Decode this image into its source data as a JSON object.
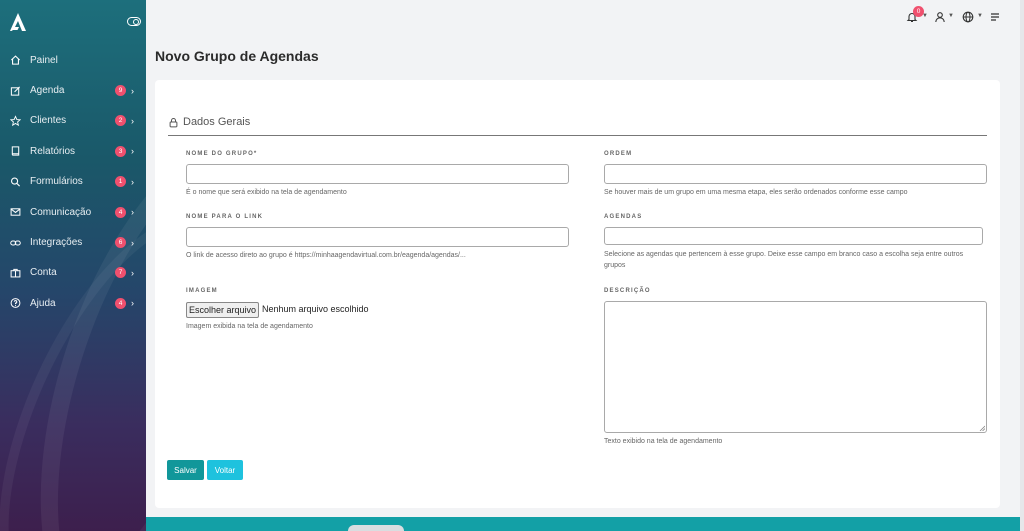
{
  "sidebar": {
    "items": [
      {
        "label": "Painel",
        "icon": "home-icon",
        "badge": null
      },
      {
        "label": "Agenda",
        "icon": "edit-icon",
        "badge": "9"
      },
      {
        "label": "Clientes",
        "icon": "star-icon",
        "badge": "2"
      },
      {
        "label": "Relatórios",
        "icon": "book-icon",
        "badge": "3"
      },
      {
        "label": "Formulários",
        "icon": "search-icon",
        "badge": "1"
      },
      {
        "label": "Comunicação",
        "icon": "mail-icon",
        "badge": "4"
      },
      {
        "label": "Integrações",
        "icon": "link-icon",
        "badge": "6"
      },
      {
        "label": "Conta",
        "icon": "briefcase-icon",
        "badge": "7"
      },
      {
        "label": "Ajuda",
        "icon": "help-icon",
        "badge": "4"
      }
    ]
  },
  "topbar": {
    "notifications_count": "0"
  },
  "page": {
    "title": "Novo Grupo de Agendas"
  },
  "form": {
    "section_title": "Dados Gerais",
    "nome_grupo_label": "NOME DO GRUPO*",
    "nome_grupo_help": "É o nome que será exibido na tela de agendamento",
    "ordem_label": "ORDEM",
    "ordem_help": "Se houver mais de um grupo em uma mesma etapa, eles serão ordenados conforme esse campo",
    "nome_link_label": "NOME PARA O LINK",
    "nome_link_help": "O link de acesso direto ao grupo é https://minhaagendavirtual.com.br/eagenda/agendas/...",
    "agendas_label": "AGENDAS",
    "agendas_help": "Selecione as agendas que pertencem à esse grupo. Deixe esse campo em branco caso a escolha seja entre outros grupos",
    "imagem_label": "IMAGEM",
    "file_button": "Escolher arquivo",
    "file_status": "Nenhum arquivo escolhido",
    "imagem_help": "Imagem exibida na tela de agendamento",
    "descricao_label": "DESCRIÇÃO",
    "descricao_help": "Texto exibido na tela de agendamento",
    "save_label": "Salvar",
    "back_label": "Voltar"
  },
  "colors": {
    "accent": "#11979a",
    "accent_light": "#1ec2de",
    "badge": "#f0506e"
  }
}
